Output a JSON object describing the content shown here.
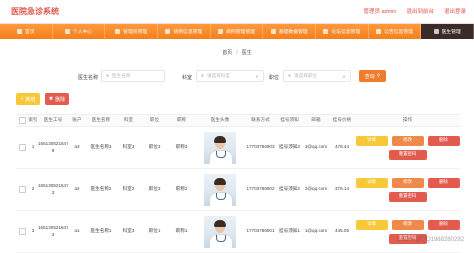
{
  "header": {
    "app_title": "医院急诊系统",
    "user_label": "管理员 admin",
    "home_link": "退出到前台",
    "logout_link": "退出登录"
  },
  "nav": {
    "items": [
      {
        "label": "首页"
      },
      {
        "label": "个人中心"
      },
      {
        "label": "管理员管理"
      },
      {
        "label": "病例信息管理"
      },
      {
        "label": "病例管理管理"
      },
      {
        "label": "基础数据管理"
      },
      {
        "label": "论坛信息管理"
      },
      {
        "label": "公告信息管理"
      },
      {
        "label": "医生管理"
      }
    ],
    "active_index": 8
  },
  "breadcrumb": {
    "home": "首页",
    "current": "医生"
  },
  "search": {
    "name_label": "医生名称",
    "name_placeholder": "医生名称",
    "dept_label": "科室",
    "dept_placeholder": "请选择科室",
    "job_label": "职位",
    "job_placeholder": "请选择职位",
    "search_button": "查询"
  },
  "actions": {
    "add_button": "新增",
    "delete_button": "删除"
  },
  "table": {
    "headers": [
      "",
      "索引",
      "医生工号",
      "账户",
      "医生名称",
      "科室",
      "职位",
      "职称",
      "医生头像",
      "联系方式",
      "挂号须知",
      "邮箱",
      "挂号价格",
      "操作"
    ],
    "rows": [
      {
        "index": "1",
        "no": "16513052164749 9",
        "account": "a3",
        "name": "医生名称3",
        "dept": "科室3",
        "job": "职位3",
        "title": "职称3",
        "phone": "17703786903",
        "level": "挂号须知3",
        "email": "3@qq.com",
        "fee": "478.44"
      },
      {
        "index": "2",
        "no": "16513052164747 3",
        "account": "a2",
        "name": "医生名称2",
        "dept": "科室2",
        "job": "职位3",
        "title": "职称2",
        "phone": "17703786902",
        "level": "挂号须知2",
        "email": "2@qq.com",
        "fee": "376.14"
      },
      {
        "index": "3",
        "no": "16513052164770 3",
        "account": "a1",
        "name": "医生名称1",
        "dept": "科室3",
        "job": "职位1",
        "title": "职称1",
        "phone": "17703786901",
        "level": "挂号须知1",
        "email": "1@qq.com",
        "fee": "445.05"
      }
    ],
    "row_actions": {
      "detail": "详情",
      "edit": "修改",
      "delete": "删除",
      "reset": "重置密码"
    }
  },
  "watermark": "CSDN @QQ1988280292",
  "colors": {
    "accent": "#f07b2c",
    "nav_active": "#3a2b28",
    "title": "#e0564f"
  }
}
